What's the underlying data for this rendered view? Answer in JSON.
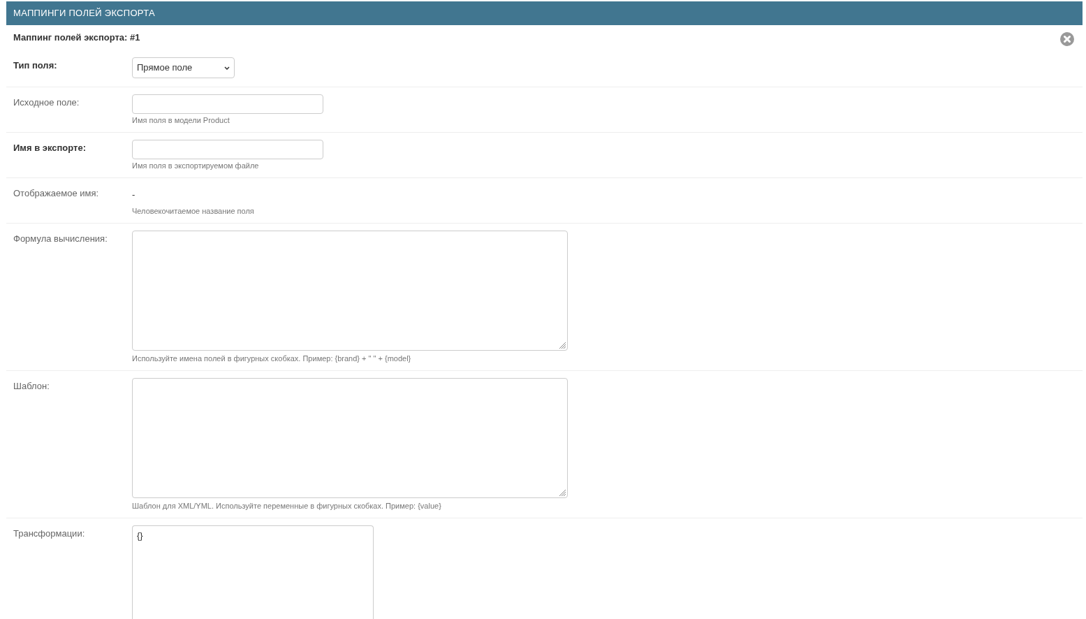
{
  "section": {
    "title": "МАППИНГИ ПОЛЕЙ ЭКСПОРТА"
  },
  "inline_form": {
    "title": "Маппинг полей экспорта: #1",
    "fields": [
      {
        "kind": "select",
        "label": "Тип поля:",
        "required": true,
        "value": "Прямое поле"
      },
      {
        "kind": "input",
        "label": "Исходное поле:",
        "required": false,
        "help": "Имя поля в модели Product"
      },
      {
        "kind": "input",
        "label": "Имя в экспорте:",
        "required": true,
        "help": "Имя поля в экспортируемом файле"
      },
      {
        "kind": "readonly",
        "label": "Отображаемое имя:",
        "required": false,
        "value": "-",
        "help": "Человекочитаемое название поля"
      },
      {
        "kind": "textarea",
        "label": "Формула вычисления:",
        "required": false,
        "help": "Используйте имена полей в фигурных скобках. Пример: {brand} + \" \" + {model}"
      },
      {
        "kind": "textarea",
        "label": "Шаблон:",
        "required": false,
        "help": "Шаблон для XML/YML. Используйте переменные в фигурных скобках. Пример: {value}"
      },
      {
        "kind": "json_textarea",
        "label": "Трансформации:",
        "required": false,
        "value": "{}"
      }
    ]
  }
}
